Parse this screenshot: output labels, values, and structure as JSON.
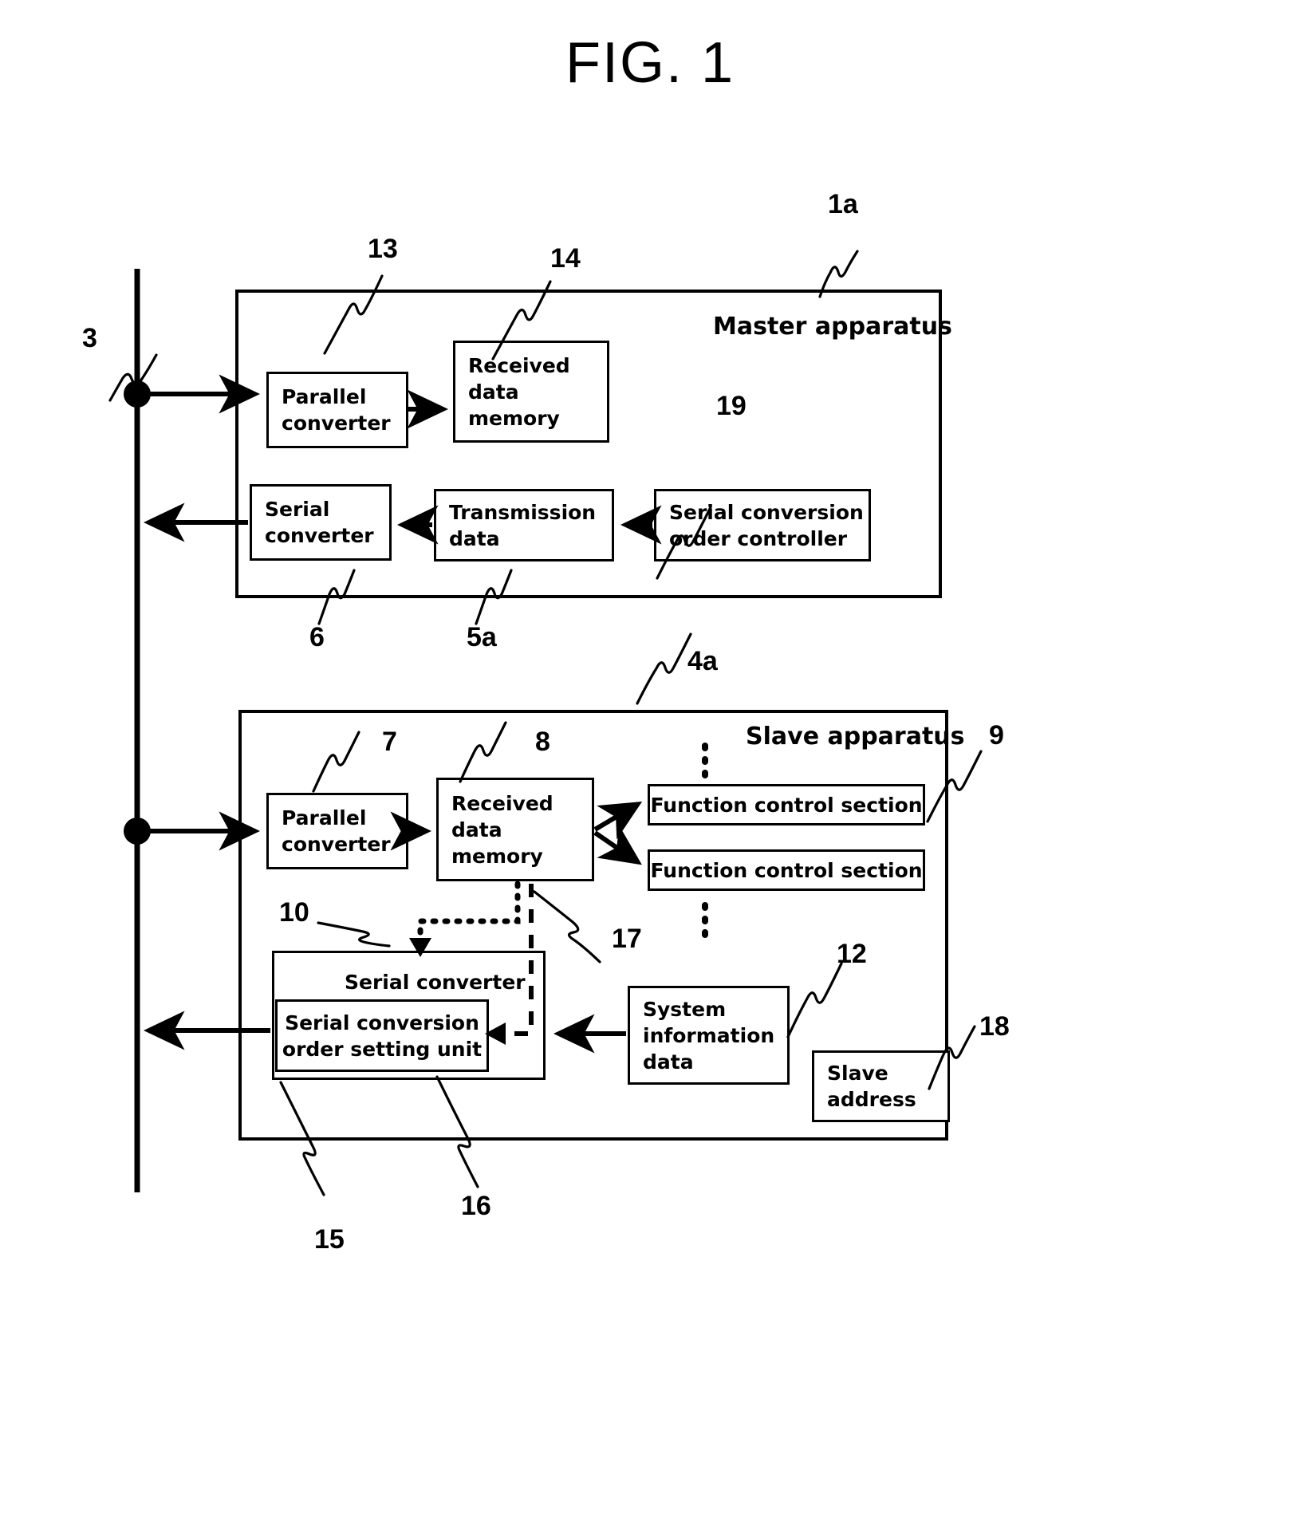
{
  "figure": {
    "title": "FIG. 1"
  },
  "bus": {
    "ref": "3"
  },
  "master": {
    "label": "Master apparatus",
    "ref": "1a",
    "blocks": [
      {
        "ref": "13",
        "lines": [
          "Parallel",
          "converter"
        ],
        "name": "parallel-converter"
      },
      {
        "ref": "14",
        "lines": [
          "Received",
          "data",
          "memory"
        ],
        "name": "received-data-memory"
      },
      {
        "ref": "6",
        "lines": [
          "Serial",
          "converter"
        ],
        "name": "serial-converter"
      },
      {
        "ref": "5a",
        "lines": [
          "Transmission",
          "data"
        ],
        "name": "transmission-data"
      },
      {
        "ref": "19",
        "lines": [
          "Serial conversion",
          "order controller"
        ],
        "name": "serial-conversion-order-controller"
      }
    ]
  },
  "slave": {
    "label": "Slave apparatus",
    "ref": "4a",
    "blocks": [
      {
        "ref": "7",
        "lines": [
          "Parallel",
          "converter"
        ],
        "name": "parallel-converter"
      },
      {
        "ref": "8",
        "lines": [
          "Received",
          "data",
          "memory"
        ],
        "name": "received-data-memory"
      },
      {
        "ref": "9",
        "lines": [
          "Function control section"
        ],
        "name": "function-control-section-1"
      },
      {
        "ref": "",
        "lines": [
          "Function control section"
        ],
        "name": "function-control-section-2"
      },
      {
        "ref": "15",
        "lines": [
          "Serial converter"
        ],
        "name": "serial-converter"
      },
      {
        "ref": "16",
        "lines": [
          "Serial conversion",
          "order setting unit"
        ],
        "name": "serial-conversion-order-setting-unit"
      },
      {
        "ref": "12",
        "lines": [
          "System",
          "information",
          "data"
        ],
        "name": "system-information-data"
      },
      {
        "ref": "18",
        "lines": [
          "Slave",
          "address"
        ],
        "name": "slave-address"
      }
    ],
    "signal_ref": "17",
    "setting_ref": "10"
  },
  "refs": {
    "r1a": "1a",
    "r3": "3",
    "r4a": "4a",
    "r5a": "5a",
    "r6": "6",
    "r7": "7",
    "r8": "8",
    "r9": "9",
    "r10": "10",
    "r12": "12",
    "r13": "13",
    "r14": "14",
    "r15": "15",
    "r16": "16",
    "r17": "17",
    "r18": "18",
    "r19": "19"
  },
  "colors": {
    "ink": "#000000",
    "paper": "#ffffff"
  }
}
